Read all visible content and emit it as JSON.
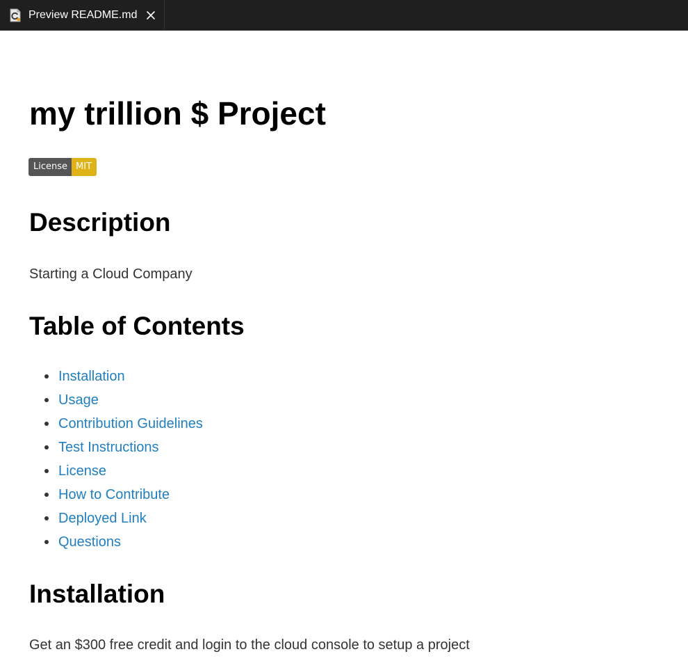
{
  "tab": {
    "title": "Preview README.md",
    "icon": "markdown-preview-icon",
    "close_icon": "close-icon"
  },
  "doc": {
    "title": "my trillion $ Project",
    "badge": {
      "label": "License",
      "value": "MIT",
      "label_color": "#555555",
      "value_color": "#dfb317"
    },
    "description": {
      "heading": "Description",
      "text": "Starting a Cloud Company"
    },
    "toc": {
      "heading": "Table of Contents",
      "items": [
        {
          "label": "Installation"
        },
        {
          "label": "Usage"
        },
        {
          "label": "Contribution Guidelines"
        },
        {
          "label": "Test Instructions"
        },
        {
          "label": "License"
        },
        {
          "label": "How to Contribute"
        },
        {
          "label": "Deployed Link"
        },
        {
          "label": "Questions"
        }
      ]
    },
    "installation": {
      "heading": "Installation",
      "text": "Get an $300 free credit and login to the cloud console to setup a project"
    }
  },
  "colors": {
    "tabbar_bg": "#1f1f1f",
    "link": "#1f7fbf",
    "body_text": "#333333"
  }
}
